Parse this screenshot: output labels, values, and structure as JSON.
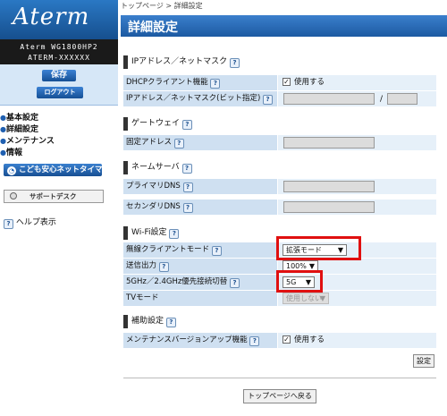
{
  "sidebar": {
    "logo": "Aterm",
    "model_line1": "Aterm WG1800HP2",
    "model_line2": "ATERM-XXXXXX",
    "save_label": "保存",
    "logout_label": "ログアウト",
    "nav": [
      {
        "label": "基本設定"
      },
      {
        "label": "詳細設定"
      },
      {
        "label": "メンテナンス"
      },
      {
        "label": "情報"
      }
    ],
    "timer_label": "こども安心ネットタイマー",
    "support_label": "サポートデスク",
    "help_label": "ヘルプ表示"
  },
  "breadcrumb": "トップページ > 詳細設定",
  "page_title": "詳細設定",
  "sections": {
    "ip": {
      "title": "IPアドレス／ネットマスク",
      "dhcp_label": "DHCPクライアント機能",
      "dhcp_check": "使用する",
      "ipmask_label": "IPアドレス／ネットマスク(ビット指定)",
      "slash": "/"
    },
    "gateway": {
      "title": "ゲートウェイ",
      "fixed_label": "固定アドレス"
    },
    "dns": {
      "title": "ネームサーバ",
      "primary_label": "プライマリDNS",
      "secondary_label": "セカンダリDNS"
    },
    "wifi": {
      "title": "Wi-Fi設定",
      "wireless_mode_label": "無線クライアントモード",
      "wireless_mode_value": "拡張モード",
      "tx_power_label": "送信出力",
      "tx_power_value": "100%",
      "band_label": "5GHz／2.4GHz優先接続切替",
      "band_value": "5G",
      "tv_label": "TVモード",
      "tv_value": "使用しない"
    },
    "aux": {
      "title": "補助設定",
      "maint_label": "メンテナンスバージョンアップ機能",
      "maint_check": "使用する"
    }
  },
  "apply_label": "設定",
  "back_label": "トップページへ戻る",
  "colors": {
    "accent": "#1f5fb0",
    "highlight": "#e01010"
  }
}
